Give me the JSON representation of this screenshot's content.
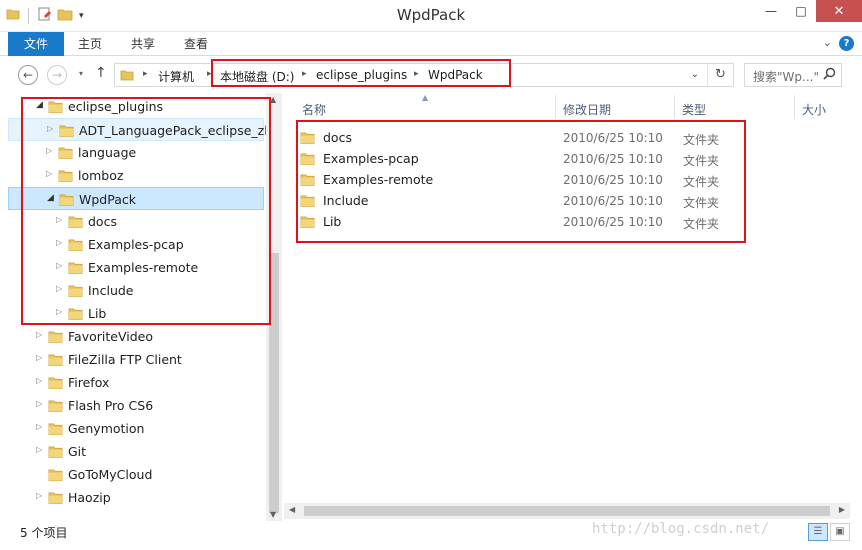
{
  "window": {
    "title": "WpdPack",
    "minimize": "—",
    "maximize": "□",
    "close": "✕"
  },
  "ribbon": {
    "tabs": [
      "文件",
      "主页",
      "共享",
      "查看"
    ],
    "help": "?"
  },
  "address": {
    "breadcrumbs": [
      "计算机",
      "本地磁盘 (D:)",
      "eclipse_plugins",
      "WpdPack"
    ],
    "search_placeholder": "搜索\"Wp...\""
  },
  "nav_tree": [
    {
      "label": "eclipse_plugins",
      "state": "open"
    },
    {
      "label": "ADT_LanguagePack_eclipse_zh",
      "state": "closed"
    },
    {
      "label": "language",
      "state": "closed"
    },
    {
      "label": "lomboz",
      "state": "closed"
    },
    {
      "label": "WpdPack",
      "state": "open"
    },
    {
      "label": "docs",
      "state": "closed"
    },
    {
      "label": "Examples-pcap",
      "state": "closed"
    },
    {
      "label": "Examples-remote",
      "state": "closed"
    },
    {
      "label": "Include",
      "state": "closed"
    },
    {
      "label": "Lib",
      "state": "closed"
    },
    {
      "label": "FavoriteVideo",
      "state": "closed"
    },
    {
      "label": "FileZilla FTP Client",
      "state": "closed"
    },
    {
      "label": "Firefox",
      "state": "closed"
    },
    {
      "label": "Flash Pro CS6",
      "state": "closed"
    },
    {
      "label": "Genymotion",
      "state": "closed"
    },
    {
      "label": "Git",
      "state": "closed"
    },
    {
      "label": "GoToMyCloud",
      "state": "none"
    },
    {
      "label": "Haozip",
      "state": "closed"
    }
  ],
  "columns": [
    "名称",
    "修改日期",
    "类型",
    "大小"
  ],
  "files": [
    {
      "name": "docs",
      "modified": "2010/6/25 10:10",
      "type": "文件夹"
    },
    {
      "name": "Examples-pcap",
      "modified": "2010/6/25 10:10",
      "type": "文件夹"
    },
    {
      "name": "Examples-remote",
      "modified": "2010/6/25 10:10",
      "type": "文件夹"
    },
    {
      "name": "Include",
      "modified": "2010/6/25 10:10",
      "type": "文件夹"
    },
    {
      "name": "Lib",
      "modified": "2010/6/25 10:10",
      "type": "文件夹"
    }
  ],
  "status": {
    "item_count": "5 个项目",
    "watermark": "http://blog.csdn.net/"
  },
  "colors": {
    "accent": "#1979ca",
    "selection": "#cce8ff",
    "annotation": "#d9141b",
    "folder": "#e8c25a"
  }
}
